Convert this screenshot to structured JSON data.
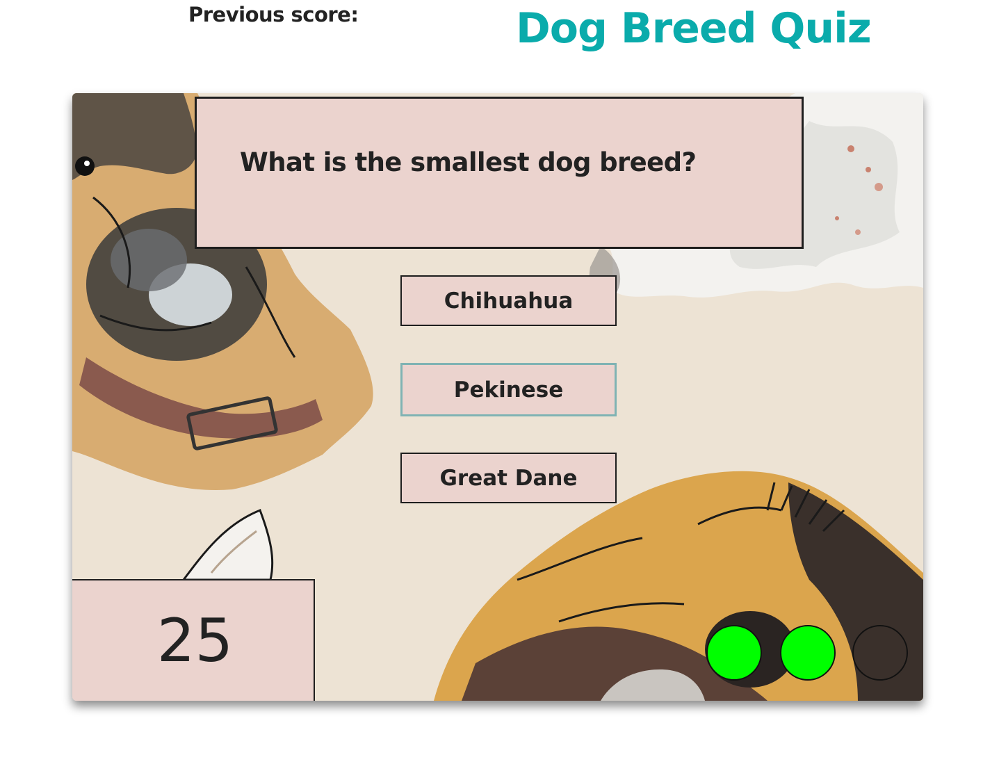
{
  "header": {
    "previous_score_label": "Previous score:",
    "title": "Dog Breed Quiz",
    "title_color": "#0aabab"
  },
  "quiz": {
    "question": "What is the smallest dog breed?",
    "answers": [
      {
        "label": "Chihuahua"
      },
      {
        "label": "Pekinese"
      },
      {
        "label": "Great Dane"
      }
    ],
    "timer": "25",
    "progress": [
      {
        "state": "correct",
        "color": "#00ff00"
      },
      {
        "state": "correct",
        "color": "#00ff00"
      },
      {
        "state": "pending",
        "color": "transparent"
      }
    ]
  },
  "colors": {
    "card_background": "#ebd3ce",
    "board_background": "#ede3d4"
  },
  "background_art": "watercolor dog illustrations"
}
